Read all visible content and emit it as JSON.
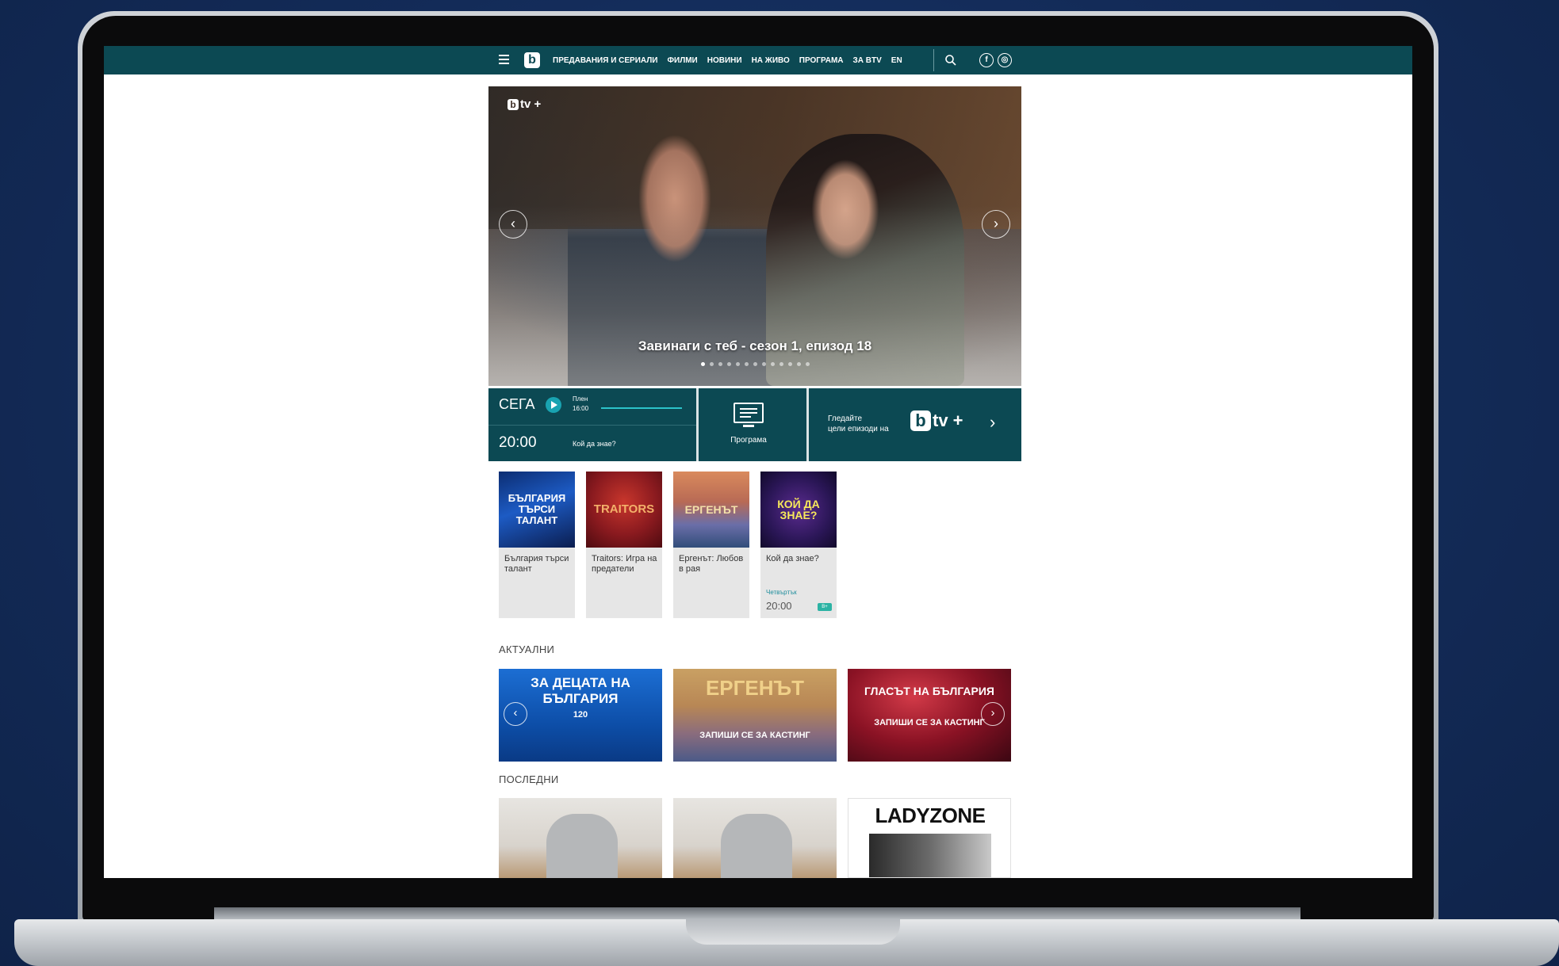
{
  "nav": {
    "links": [
      "ПРЕДАВАНИЯ И СЕРИАЛИ",
      "ФИЛМИ",
      "НОВИНИ",
      "НА ЖИВО",
      "ПРОГРАМА",
      "ЗА BTV",
      "EN"
    ],
    "logo": "b"
  },
  "hero": {
    "brand": "tv +",
    "caption": "Завинаги с теб - сезон 1, епизод 18",
    "slide_count": 13,
    "active_slide": 1
  },
  "nowbar": {
    "now_label": "СЕГА",
    "now_show": "Плен",
    "now_time": "16:00",
    "progress": 1.0,
    "next_time": "20:00",
    "next_show": "Кой да знае?",
    "program_label": "Програма",
    "watch_line1": "Гледайте",
    "watch_line2": "цели епизоди на",
    "brand": "tv +"
  },
  "shows": [
    {
      "title": "България търси талант",
      "thumb": "БЪЛГАРИЯ ТЪРСИ ТАЛАНТ"
    },
    {
      "title": "Traitors: Игра на предатели",
      "thumb": "TRAITORS"
    },
    {
      "title": "Ергенът: Любов в рая",
      "thumb": "ЕРГЕНЪТ"
    },
    {
      "title": "Кой да знае?",
      "thumb": "КОЙ ДА ЗНАЕ?",
      "day": "Четвъртък",
      "time": "20:00",
      "badge": "B+"
    }
  ],
  "sections": {
    "current": "АКТУАЛНИ",
    "latest": "ПОСЛЕДНИ"
  },
  "current_tiles": [
    {
      "title": "ЗА ДЕЦАТА НА БЪЛГАРИЯ",
      "sub": "120"
    },
    {
      "title": "ЕРГЕНЪТ",
      "sub": "ЗАПИШИ СЕ ЗА КАСТИНГ"
    },
    {
      "title": "ГЛАСЪТ НА БЪЛГАРИЯ",
      "sub": "ЗАПИШИ СЕ ЗА КАСТИНГ"
    }
  ],
  "latest_tiles": [
    {
      "title": ""
    },
    {
      "title": ""
    },
    {
      "title": "LADYZONE"
    }
  ],
  "colors": {
    "brand_teal": "#0c4953",
    "accent": "#2cc2c9",
    "background": "#14305f"
  }
}
